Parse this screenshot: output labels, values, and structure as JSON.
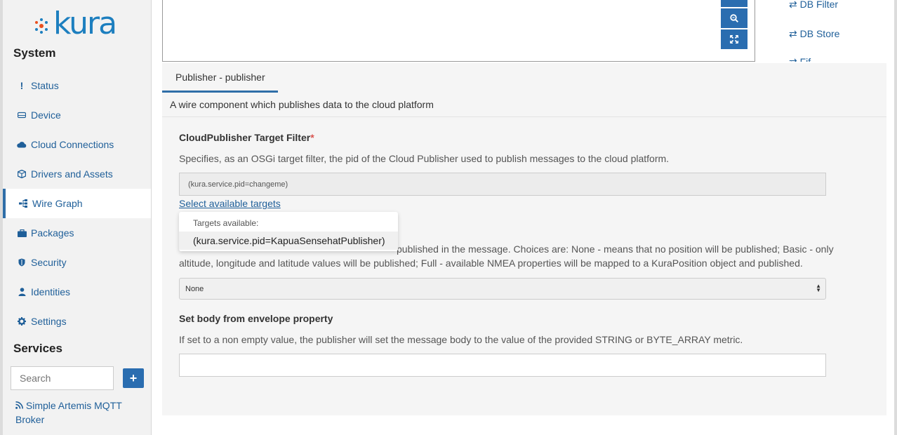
{
  "app": {
    "logo_text": "kura"
  },
  "sidebar": {
    "system_title": "System",
    "items": [
      {
        "label": "Status",
        "icon": "exclamation-icon"
      },
      {
        "label": "Device",
        "icon": "device-icon"
      },
      {
        "label": "Cloud Connections",
        "icon": "cloud-icon"
      },
      {
        "label": "Drivers and Assets",
        "icon": "cube-icon"
      },
      {
        "label": "Wire Graph",
        "icon": "sitemap-icon",
        "active": true
      },
      {
        "label": "Packages",
        "icon": "briefcase-icon"
      },
      {
        "label": "Security",
        "icon": "shield-icon"
      },
      {
        "label": "Identities",
        "icon": "user-icon"
      },
      {
        "label": "Settings",
        "icon": "gear-icon"
      }
    ],
    "services_title": "Services",
    "search_placeholder": "Search",
    "add_label": "+",
    "service_item": "Simple Artemis MQTT Broker"
  },
  "palette": {
    "items": [
      "DB Filter",
      "DB Store",
      "Fif"
    ]
  },
  "panel": {
    "tab_label": "Publisher - publisher",
    "description": "A wire component which publishes data to the cloud platform",
    "field1": {
      "label": "CloudPublisher Target Filter",
      "required_mark": "*",
      "help": "Specifies, as an OSGi target filter, the pid of the Cloud Publisher used to publish messages to the cloud platform.",
      "value": "(kura.service.pid=changeme)",
      "link": "Select available targets"
    },
    "popup": {
      "title": "Targets available:",
      "item": "(kura.service.pid=KapuaSensehatPublisher)"
    },
    "field2": {
      "help_line1": "published in the message. Choices are: None - means that no position will be published; Basic - only",
      "help_line2": "altitude, longitude and latitude values will be published; Full - available NMEA properties will be mapped to a KuraPosition object and published.",
      "selected": "None"
    },
    "field3": {
      "label": "Set body from envelope property",
      "help": "If set to a non empty value, the publisher will set the message body to the value of the provided STRING or BYTE_ARRAY metric.",
      "value": ""
    }
  },
  "colors": {
    "accent": "#2a6db0",
    "link": "#1f5f99",
    "brand": "#1d7fbf"
  }
}
